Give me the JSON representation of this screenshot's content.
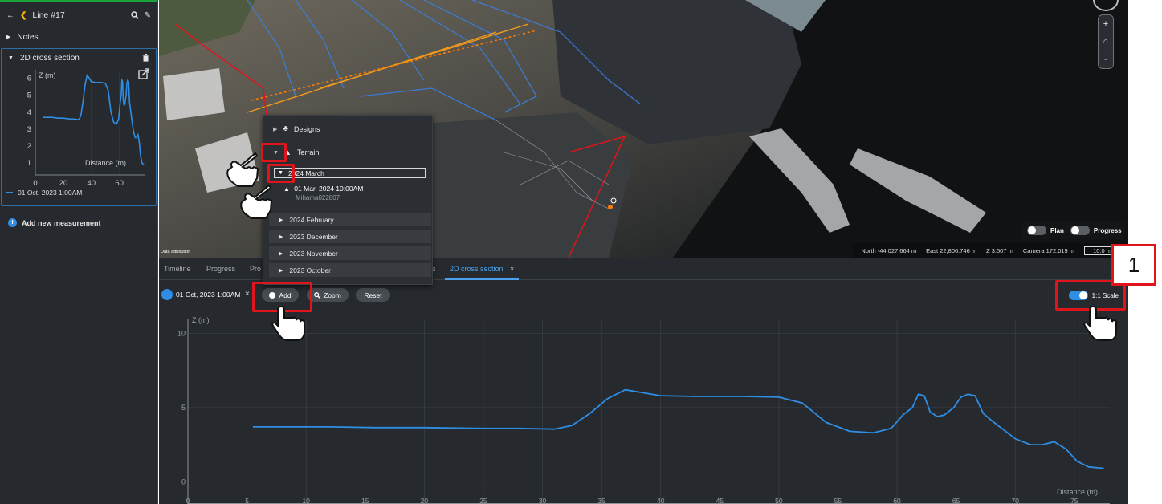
{
  "sidebar": {
    "title": "Line #17",
    "notes_label": "Notes",
    "cross_section_label": "2D cross section",
    "mini_chart": {
      "y_label": "Z (m)",
      "x_label": "Distance (m)",
      "y_ticks": [
        "6",
        "5",
        "4",
        "3",
        "2",
        "1"
      ],
      "x_ticks": [
        "0",
        "20",
        "40",
        "60"
      ]
    },
    "legend_label": "01 Oct, 2023 1:00AM",
    "add_measurement_label": "Add new measurement"
  },
  "view3d": {
    "attribution": "Data attribution",
    "toggles": {
      "plan_label": "Plan",
      "progress_label": "Progress"
    },
    "coords": {
      "north": "North -44,027.664 m",
      "east": "East 22,806.746 m",
      "z": "Z 3.507 m",
      "camera": "Camera 172.019 m",
      "scale": "10.0 m"
    },
    "map_controls": {
      "zoom_in": "+",
      "zoom_out": "-"
    }
  },
  "layer_panel": {
    "designs_label": "Designs",
    "terrain_label": "Terrain",
    "selected_label": "2024 March",
    "entry_date": "01 Mar, 2024 10:00AM",
    "entry_user": "Mihama022807",
    "items": [
      "2024 February",
      "2023 December",
      "2023 November",
      "2023 October"
    ]
  },
  "bottom": {
    "tabs": {
      "timeline": "Timeline",
      "progress": "Progress",
      "partial": "Pro",
      "partial_right": "s",
      "cross_section": "2D cross section"
    },
    "toolbar": {
      "dataset_label": "01 Oct, 2023 1:00AM",
      "remove_icon": "×",
      "add_label": "Add",
      "zoom_label": "Zoom",
      "reset_label": "Reset",
      "scale_label": "1:1 Scale"
    }
  },
  "annotation": {
    "callout_number": "1",
    "highlight_color": "#e0141b"
  },
  "colors": {
    "accent": "#2f8de4",
    "panel": "#26292d",
    "sidebar_topbar": "#19a33a"
  },
  "chart_data": {
    "type": "line",
    "title": "",
    "xlabel": "Distance (m)",
    "ylabel": "Z (m)",
    "xlim": [
      0,
      78
    ],
    "ylim": [
      -1.5,
      11
    ],
    "x_ticks": [
      0,
      5,
      10,
      15,
      20,
      25,
      30,
      35,
      40,
      45,
      50,
      55,
      60,
      65,
      70,
      75
    ],
    "y_ticks": [
      0,
      5,
      10
    ],
    "grid": true,
    "series": [
      {
        "name": "01 Oct, 2023 1:00AM",
        "color": "#2f8de4",
        "x": [
          5.5,
          8,
          12,
          16,
          20,
          25,
          28,
          31,
          32.5,
          34,
          35.5,
          37,
          38.5,
          40,
          43,
          47,
          50,
          52,
          54,
          56,
          58,
          59.5,
          60.5,
          61.3,
          61.8,
          62.3,
          62.8,
          63.4,
          64,
          64.8,
          65.4,
          66,
          66.6,
          67.3,
          68.2,
          70,
          71.3,
          72.3,
          73.3,
          74.3,
          75.2,
          76.2,
          77.5
        ],
        "y": [
          3.7,
          3.7,
          3.7,
          3.65,
          3.65,
          3.6,
          3.6,
          3.55,
          3.8,
          4.6,
          5.6,
          6.2,
          6.0,
          5.8,
          5.75,
          5.75,
          5.7,
          5.3,
          4.0,
          3.4,
          3.3,
          3.6,
          4.5,
          5.0,
          5.9,
          5.8,
          4.7,
          4.4,
          4.5,
          5.0,
          5.7,
          5.9,
          5.8,
          4.6,
          4.0,
          2.9,
          2.5,
          2.5,
          2.7,
          2.2,
          1.4,
          1.0,
          0.9
        ]
      }
    ]
  }
}
